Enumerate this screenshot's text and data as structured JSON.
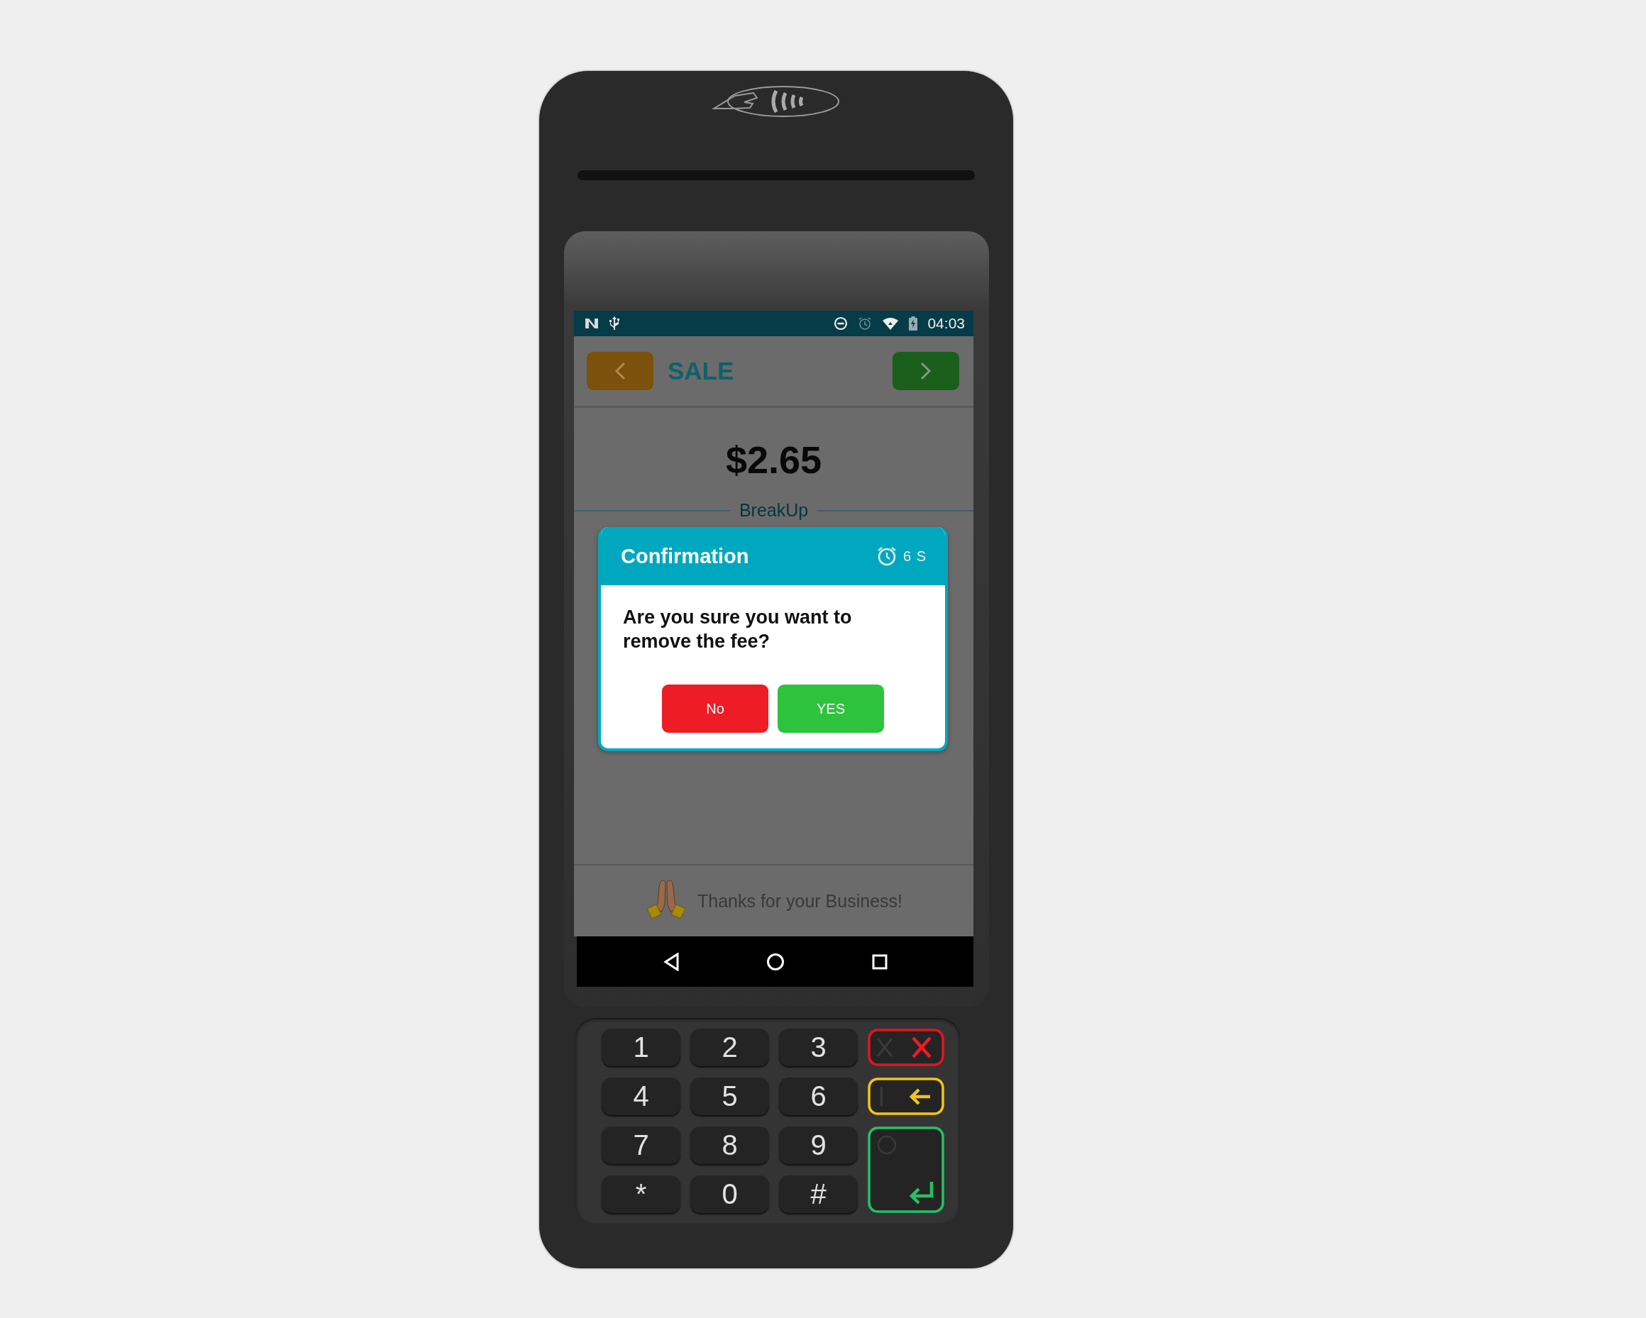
{
  "status_bar": {
    "time": "04:03"
  },
  "header": {
    "title": "SALE"
  },
  "amount": "$2.65",
  "section_label": "BreakUp",
  "footer": {
    "message": "Thanks for your Business!"
  },
  "dialog": {
    "title": "Confirmation",
    "timer": "6 S",
    "message": "Are you sure you want to remove the fee?",
    "buttons": [
      {
        "label": "No",
        "kind": "cancel"
      },
      {
        "label": "YES",
        "kind": "confirm"
      }
    ]
  },
  "keypad": {
    "keys": [
      "1",
      "2",
      "3",
      "4",
      "5",
      "6",
      "7",
      "8",
      "9",
      "*",
      "0",
      "#"
    ]
  }
}
